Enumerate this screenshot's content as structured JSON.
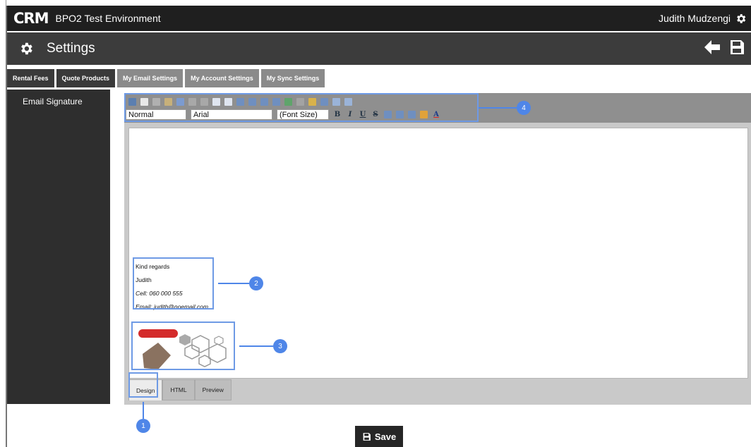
{
  "app": {
    "logo": "CRM",
    "title": "BPO2 Test Environment",
    "user": "Judith Mudzengi"
  },
  "header": {
    "title": "Settings"
  },
  "tabs": [
    {
      "label": "Rental Fees"
    },
    {
      "label": "Quote Products"
    },
    {
      "label": "My Email Settings"
    },
    {
      "label": "My Account Settings"
    },
    {
      "label": "My Sync Settings"
    }
  ],
  "sidebar": {
    "items": [
      {
        "label": "Email Signature"
      }
    ]
  },
  "editor": {
    "format_select": "Normal",
    "font_select": "Arial",
    "size_select": "(Font Size)",
    "signature": {
      "line1": "Kind regards",
      "line2": "Judith",
      "line3": "Cell: 060 000 555",
      "line4": "Email: judith@noemail.com"
    },
    "bottom_tabs": [
      {
        "label": "Design"
      },
      {
        "label": "HTML"
      },
      {
        "label": "Preview"
      }
    ]
  },
  "annotations": [
    "1",
    "2",
    "3",
    "4"
  ],
  "save_button": {
    "label": "Save"
  },
  "colors": {
    "accent": "#4f86e8",
    "topbar": "#1f1f1f",
    "settingsbar": "#3c3c3c"
  }
}
